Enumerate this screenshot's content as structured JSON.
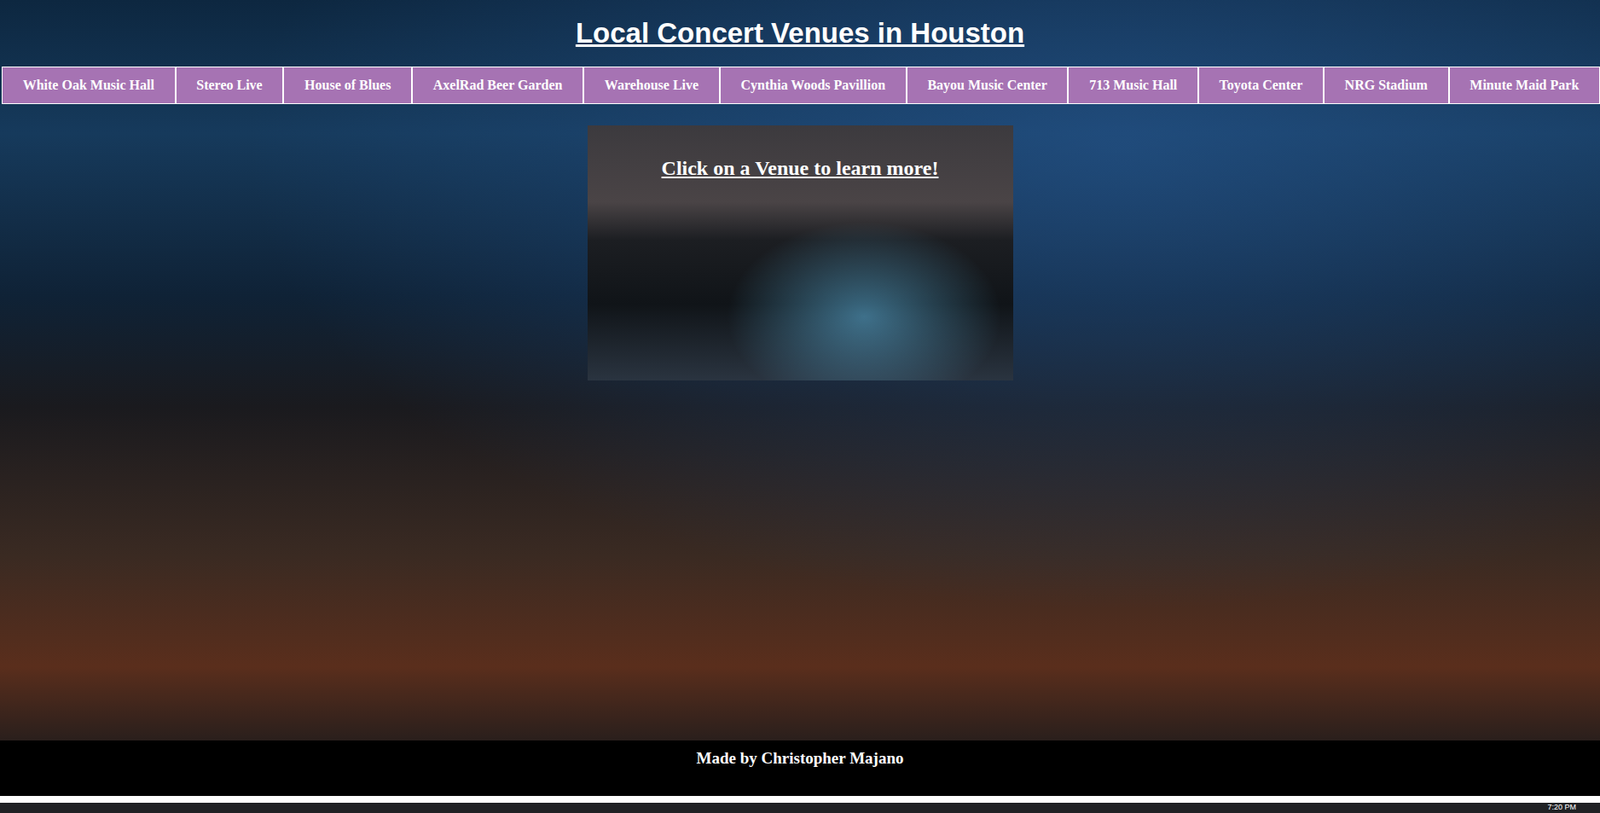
{
  "page": {
    "title": "Local Concert Venues in Houston"
  },
  "nav": {
    "items": [
      {
        "label": "White Oak Music Hall"
      },
      {
        "label": "Stereo Live"
      },
      {
        "label": "House of Blues"
      },
      {
        "label": "AxelRad Beer Garden"
      },
      {
        "label": "Warehouse Live"
      },
      {
        "label": "Cynthia Woods Pavillion"
      },
      {
        "label": "Bayou Music Center"
      },
      {
        "label": "713 Music Hall"
      },
      {
        "label": "Toyota Center"
      },
      {
        "label": "NRG Stadium"
      },
      {
        "label": "Minute Maid Park"
      }
    ]
  },
  "card": {
    "prompt": "Click on a Venue to learn more!"
  },
  "footer": {
    "credit": "Made by Christopher Majano"
  },
  "taskbar": {
    "clock": "7:20 PM"
  }
}
